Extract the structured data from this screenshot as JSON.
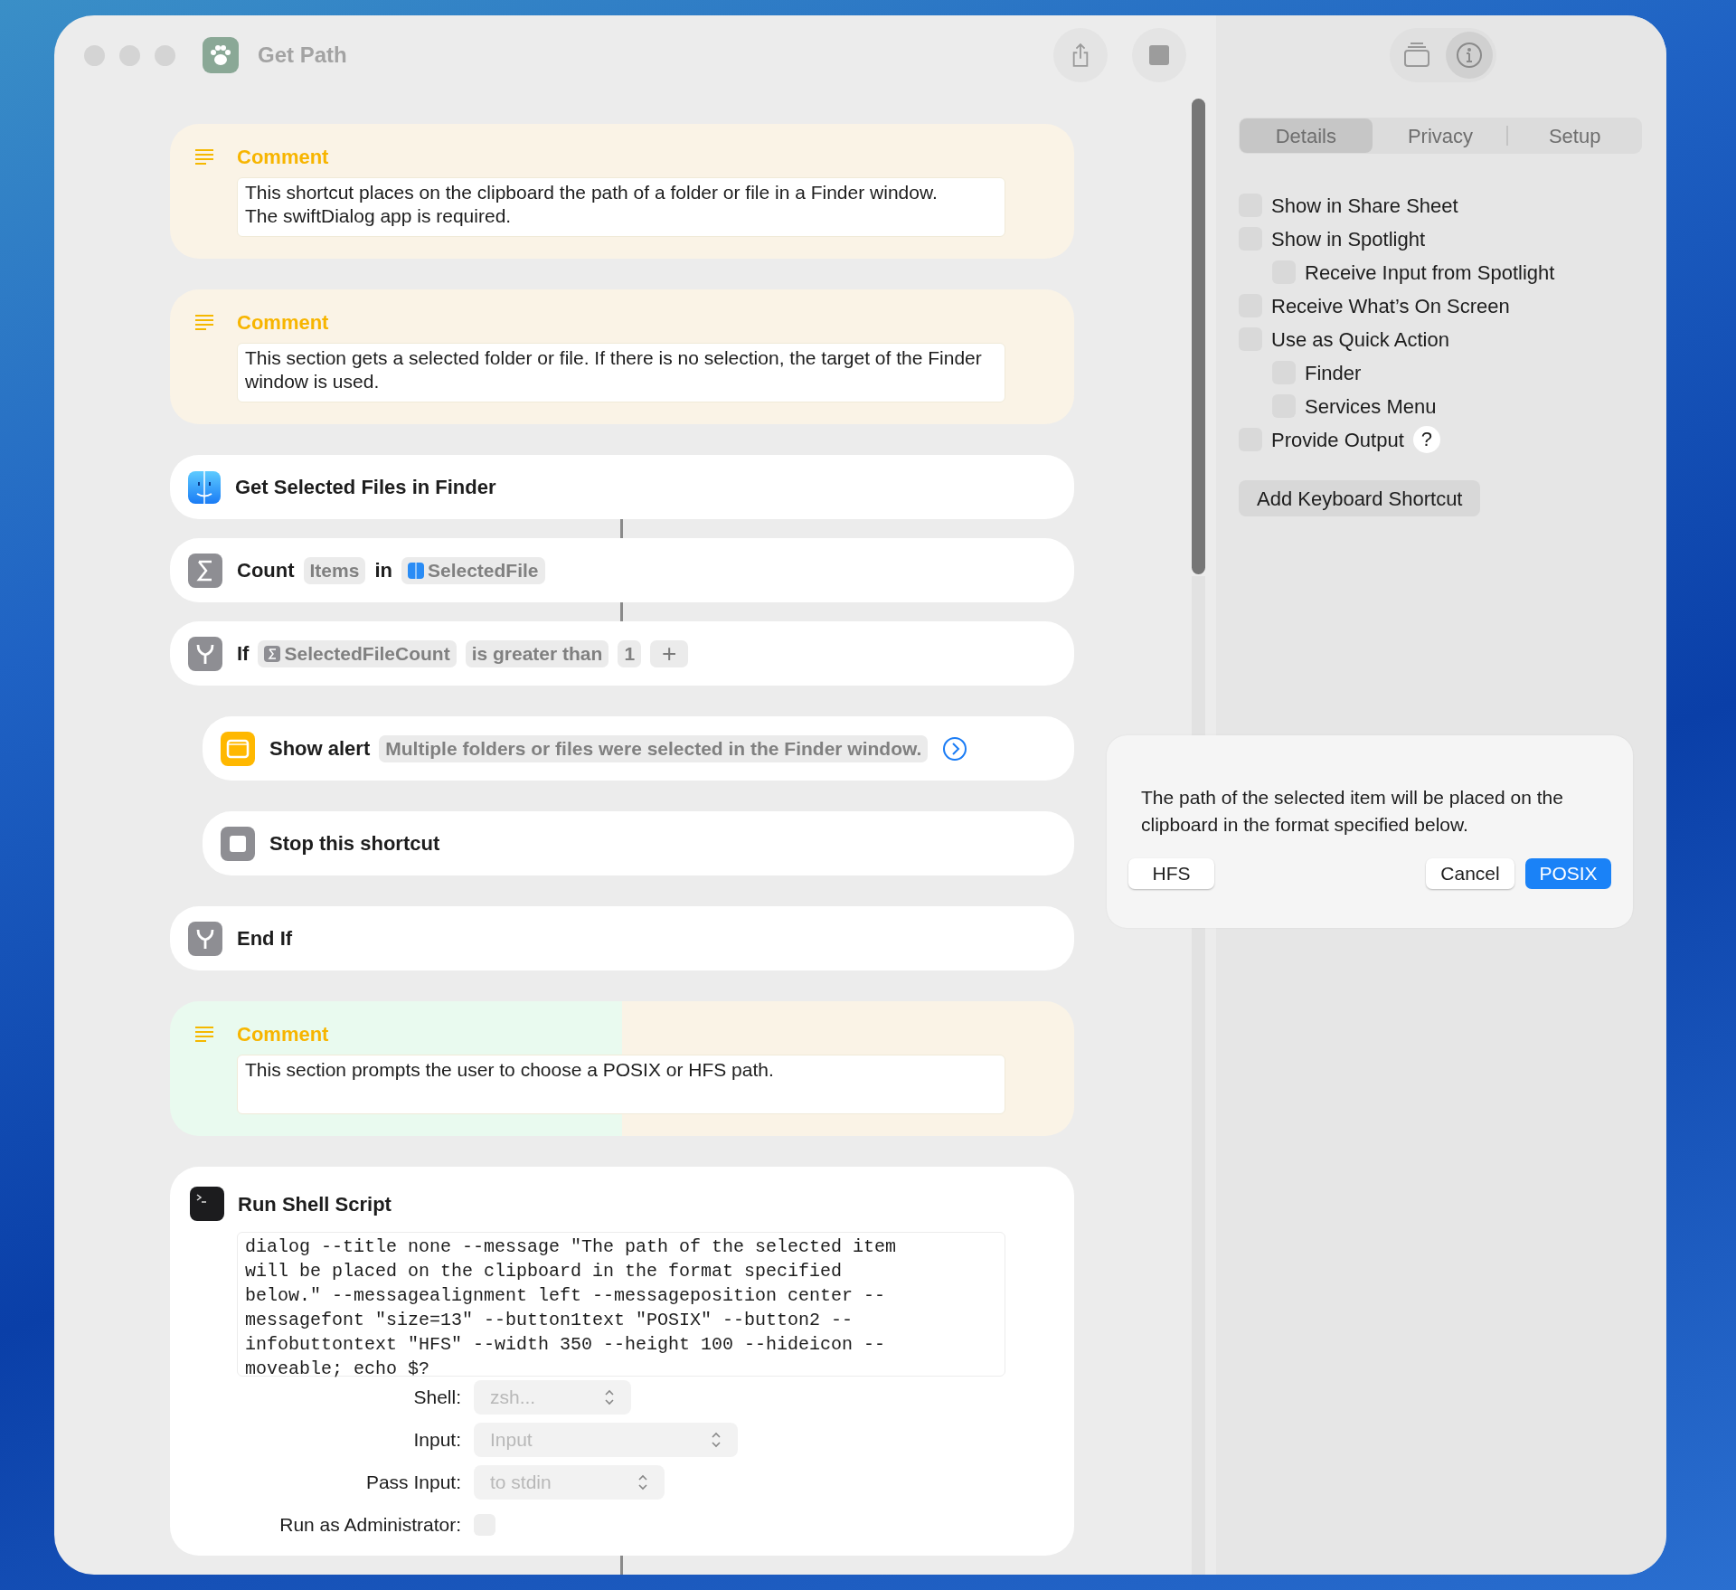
{
  "window": {
    "title": "Get Path"
  },
  "toolbar": {
    "sidebar_buttons": [
      {
        "kind": "library",
        "selected": false
      },
      {
        "kind": "info",
        "selected": true
      }
    ]
  },
  "actions": [
    {
      "kind": "comment",
      "title": "Comment",
      "text": "This shortcut places on the clipboard the path of a folder or file in a Finder window.\nThe swiftDialog app is required.",
      "indented": false,
      "highlighted": false
    },
    {
      "kind": "comment",
      "title": "Comment",
      "text": "This section gets a selected folder or file. If there is no selection, the target of the Finder window is used.",
      "indented": false,
      "connected_above": false,
      "highlighted": false
    },
    {
      "kind": "get_files",
      "parts": [
        {
          "kind": "label",
          "text": "Get Selected Files in Finder"
        }
      ],
      "indented": false,
      "connected_above": false
    },
    {
      "kind": "count",
      "parts": [
        {
          "kind": "label",
          "text": "Count"
        },
        {
          "kind": "token",
          "text": "Items"
        },
        {
          "kind": "label",
          "text": "in"
        },
        {
          "kind": "file_variable",
          "text": "SelectedFile"
        }
      ],
      "indented": false,
      "connected_above": true
    },
    {
      "kind": "if",
      "parts": [
        {
          "kind": "label",
          "text": "If"
        },
        {
          "kind": "count_variable",
          "text": "SelectedFileCount"
        },
        {
          "kind": "token",
          "text": "is greater than"
        },
        {
          "kind": "token",
          "text": "1"
        },
        {
          "kind": "add",
          "text": "+"
        }
      ],
      "indented": false,
      "connected_above": true
    },
    {
      "kind": "show_alert",
      "parts": [
        {
          "kind": "label",
          "text": "Show alert"
        },
        {
          "kind": "token",
          "text": "Multiple folders or files were selected in the Finder window."
        },
        {
          "kind": "expand"
        }
      ],
      "indented": true,
      "connected_above": false
    },
    {
      "kind": "stop",
      "parts": [
        {
          "kind": "label",
          "text": "Stop this shortcut"
        }
      ],
      "indented": true,
      "connected_above": false
    },
    {
      "kind": "end_if",
      "parts": [
        {
          "kind": "label",
          "text": "End If"
        }
      ],
      "indented": false,
      "connected_above": false
    },
    {
      "kind": "comment",
      "title": "Comment",
      "text": "This section prompts the user to choose a POSIX or HFS path.",
      "indented": false,
      "connected_above": false,
      "highlighted": true
    },
    {
      "kind": "shell",
      "title": "Run Shell Script",
      "script_lines": [
        "dialog --title none --message \"The path of the selected item",
        "will be placed on the clipboard in the format specified",
        "below.\" --messagealignment left --messageposition center --",
        "messagefont \"size=13\" --button1text \"POSIX\" --button2 --",
        "infobuttontext \"HFS\" --width 350 --height 100 --hideicon --",
        "moveable; echo $?"
      ],
      "options": [
        {
          "kind": "popup",
          "label": "Shell:",
          "value": "zsh..."
        },
        {
          "kind": "popup",
          "label": "Input:",
          "value": "Input"
        },
        {
          "kind": "popup",
          "label": "Pass Input:",
          "value": "to stdin"
        },
        {
          "kind": "checkbox",
          "label": "Run as Administrator:",
          "checked": false
        }
      ],
      "indented": false,
      "connected_above": false,
      "connected_below": true
    }
  ],
  "inspector": {
    "tabs": [
      {
        "label": "Details",
        "selected": true
      },
      {
        "label": "Privacy",
        "selected": false
      },
      {
        "label": "Setup",
        "selected": false
      }
    ],
    "options": [
      {
        "label": "Show in Share Sheet",
        "checked": false
      },
      {
        "label": "Show in Spotlight",
        "checked": false,
        "children": [
          {
            "label": "Receive Input from Spotlight",
            "checked": false
          }
        ]
      },
      {
        "label": "Receive What’s On Screen",
        "checked": false
      },
      {
        "label": "Use as Quick Action",
        "checked": false,
        "children": [
          {
            "label": "Finder",
            "checked": false
          },
          {
            "label": "Services Menu",
            "checked": false
          }
        ]
      },
      {
        "label": "Provide Output",
        "checked": false,
        "help": "?"
      }
    ],
    "button": "Add Keyboard Shortcut"
  },
  "dialog": {
    "message": "The path of the selected item will be placed on the clipboard in the format specified below.",
    "buttons": [
      {
        "kind": "info",
        "label": "HFS"
      },
      {
        "kind": "cancel",
        "label": "Cancel"
      },
      {
        "kind": "default",
        "label": "POSIX"
      }
    ]
  }
}
